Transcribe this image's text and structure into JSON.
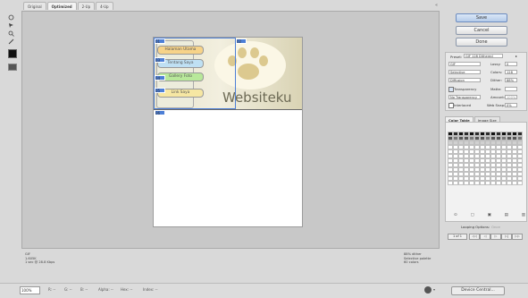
{
  "tabs": [
    {
      "label": "Original",
      "active": false
    },
    {
      "label": "Optimized",
      "active": true
    },
    {
      "label": "2-Up",
      "active": false
    },
    {
      "label": "4-Up",
      "active": false
    }
  ],
  "canvas": {
    "nav_items": [
      {
        "label": "Halaman Utama",
        "color": "#f7d389"
      },
      {
        "label": "Tentang Saya",
        "color": "#bfe0f3"
      },
      {
        "label": "Gallery Foto",
        "color": "#b8e89a"
      },
      {
        "label": "Link Saya",
        "color": "#f6e7a3"
      }
    ],
    "site_title": "Websiteku",
    "slice_labels": [
      "01",
      "02",
      "03",
      "04",
      "05",
      "06",
      "07"
    ]
  },
  "status_left": {
    "format": "GIF",
    "size": "1.605K",
    "time": "1 sec @ 28.8 Kbps"
  },
  "status_right": {
    "dither": "88% dither",
    "palette": "Selective palette",
    "colors": "60 colors"
  },
  "buttons": {
    "save": "Save",
    "cancel": "Cancel",
    "done": "Done"
  },
  "settings": {
    "preset_label": "Preset:",
    "preset_value": "GIF 128 Dithered",
    "format": "GIF",
    "reduction": "Selective",
    "dither_algo": "Diffusion",
    "transparency_label": "Transparency",
    "transparency_dither": "No Transparency ...",
    "interlaced_label": "Interlaced",
    "lossy_label": "Lossy:",
    "lossy_value": "0",
    "colors_label": "Colors:",
    "colors_value": "128",
    "dither_label": "Dither:",
    "dither_value": "88%",
    "matte_label": "Matte:",
    "amount_label": "Amount:",
    "amount_value": "100%",
    "websnap_label": "Web Snap:",
    "websnap_value": "0%"
  },
  "color_table": {
    "tabs": [
      "Color Table",
      "Image Size"
    ]
  },
  "looping": {
    "label": "Looping Options:",
    "value": "Once",
    "frame": "1 of 1"
  },
  "bottom_bar": {
    "zoom": "100%",
    "r_label": "R: --",
    "g_label": "G: --",
    "b_label": "B: --",
    "alpha_label": "Alpha: --",
    "hex_label": "Hex: --",
    "index_label": "Index: --",
    "device_central": "Device Central..."
  }
}
